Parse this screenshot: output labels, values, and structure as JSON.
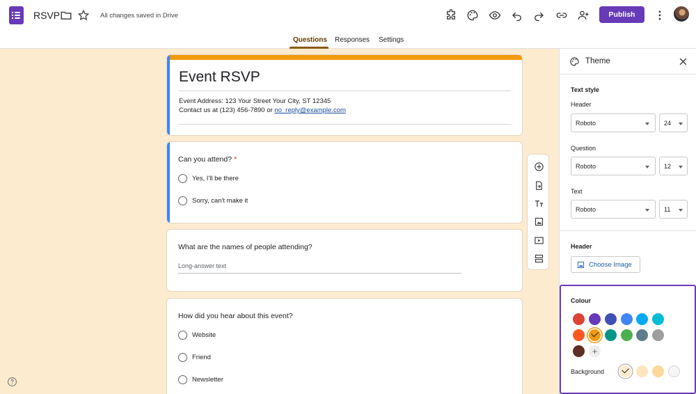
{
  "app": {
    "doc_title": "RSVP",
    "saved_status": "All changes saved in Drive",
    "publish_label": "Publish"
  },
  "tabs": [
    {
      "label": "Questions",
      "active": true
    },
    {
      "label": "Responses",
      "active": false
    },
    {
      "label": "Settings",
      "active": false
    }
  ],
  "toolbar_icons": [
    "puzzle-icon",
    "palette-icon",
    "eye-icon",
    "undo-icon",
    "redo-icon",
    "link-icon",
    "add-person-icon",
    "more-vert-icon"
  ],
  "form": {
    "title": "Event RSVP",
    "address": "Event Address: 123 Your Street Your City, ST 12345",
    "contact_prefix": "Contact us at (123) 456-7890 or ",
    "contact_email": "no_reply@example.com"
  },
  "questions": [
    {
      "title": "Can you attend?",
      "required_mark": "*",
      "options": [
        "Yes,  I'll be there",
        "Sorry, can't make it"
      ]
    },
    {
      "title": "What are the names of people attending?",
      "placeholder": "Long-answer text"
    },
    {
      "title": "How did you hear about this event?",
      "options": [
        "Website",
        "Friend",
        "Newsletter"
      ]
    }
  ],
  "side_toolbar_icons": [
    "add-question-icon",
    "import-question-icon",
    "title-text-icon",
    "image-icon",
    "video-icon",
    "section-icon"
  ],
  "theme": {
    "title": "Theme",
    "text_style_label": "Text style",
    "header_label": "Header",
    "header_font": "Roboto",
    "header_size": "24",
    "question_label": "Question",
    "question_font": "Roboto",
    "question_size": "12",
    "text_label": "Text",
    "text_font": "Roboto",
    "text_size": "11",
    "header_image_label": "Header",
    "choose_image_label": "Choose Image",
    "colour_label": "Colour",
    "background_label": "Background"
  },
  "colours": [
    "#db4437",
    "#673ab7",
    "#3f51b5",
    "#4285f4",
    "#03a9f4",
    "#00bcd4",
    "#ff5722",
    "#f29a0e",
    "#009688",
    "#4caf50",
    "#607d8b",
    "#9e9e9e",
    "#5d2e24"
  ],
  "selected_colour": "#f29a0e",
  "backgrounds": [
    "#fdebd0",
    "#fde4bf",
    "#fbd89c",
    "#f6f6f6"
  ],
  "selected_background": "#fdebd0",
  "accent": "#673ab7"
}
